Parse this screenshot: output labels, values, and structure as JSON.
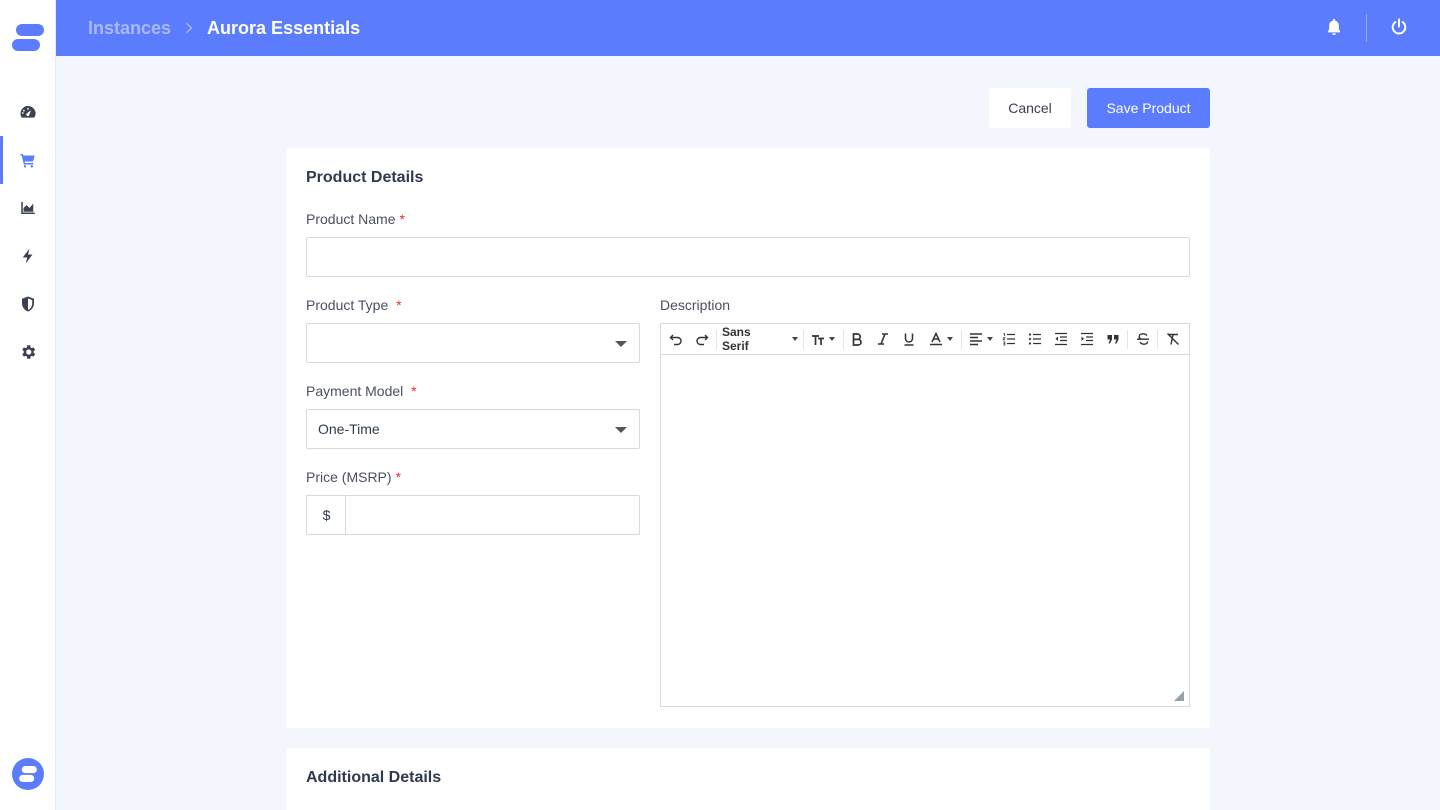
{
  "header": {
    "breadcrumb_parent": "Instances",
    "breadcrumb_current": "Aurora Essentials"
  },
  "sidebar": {
    "items": [
      {
        "icon": "dashboard-icon"
      },
      {
        "icon": "cart-icon",
        "active": true
      },
      {
        "icon": "area-chart-icon"
      },
      {
        "icon": "bolt-icon"
      },
      {
        "icon": "shield-icon"
      },
      {
        "icon": "gear-icon"
      }
    ]
  },
  "actions": {
    "cancel_label": "Cancel",
    "save_label": "Save Product"
  },
  "form": {
    "section_title": "Product Details",
    "product_name_label": "Product Name",
    "product_name_value": "",
    "product_type_label": "Product Type",
    "product_type_value": "",
    "payment_model_label": "Payment Model",
    "payment_model_value": "One-Time",
    "price_label": "Price (MSRP)",
    "price_prefix": "$",
    "price_value": "",
    "description_label": "Description",
    "required_marker": "*",
    "editor_font": "Sans Serif"
  },
  "additional": {
    "section_title": "Additional Details"
  },
  "colors": {
    "accent": "#5b7cfd",
    "required": "#e0302b",
    "background": "#f3f6fc"
  }
}
